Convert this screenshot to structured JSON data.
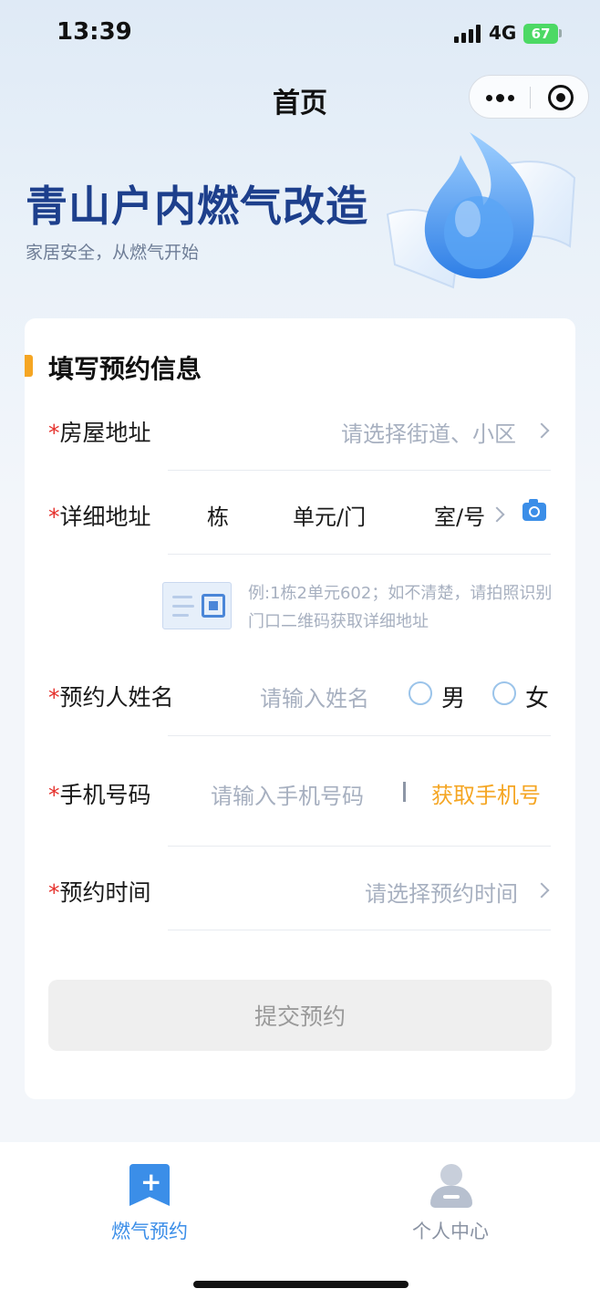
{
  "status_bar": {
    "time": "13:39",
    "network": "4G",
    "battery": "67"
  },
  "nav": {
    "title": "首页"
  },
  "hero": {
    "title": "青山户内燃气改造",
    "subtitle": "家居安全，从燃气开始"
  },
  "form": {
    "section_title": "填写预约信息",
    "required_mark": "*",
    "address": {
      "label": "房屋地址",
      "placeholder": "请选择街道、小区"
    },
    "detail": {
      "label": "详细地址",
      "building": "栋",
      "unit": "单元/门",
      "room": "室/号"
    },
    "hint": "例:1栋2单元602；如不清楚，请拍照识别门口二维码获取详细地址",
    "name": {
      "label": "预约人姓名",
      "placeholder": "请输入姓名",
      "male": "男",
      "female": "女"
    },
    "phone": {
      "label": "手机号码",
      "placeholder": "请输入手机号码",
      "get_phone": "获取手机号"
    },
    "time": {
      "label": "预约时间",
      "placeholder": "请选择预约时间"
    },
    "submit": "提交预约"
  },
  "tabbar": {
    "items": [
      {
        "label": "燃气预约",
        "active": true,
        "icon": "book-plus-icon"
      },
      {
        "label": "个人中心",
        "active": false,
        "icon": "person-icon"
      }
    ],
    "active_color": "#3b8ee8",
    "inactive_color": "#8a93a3"
  }
}
